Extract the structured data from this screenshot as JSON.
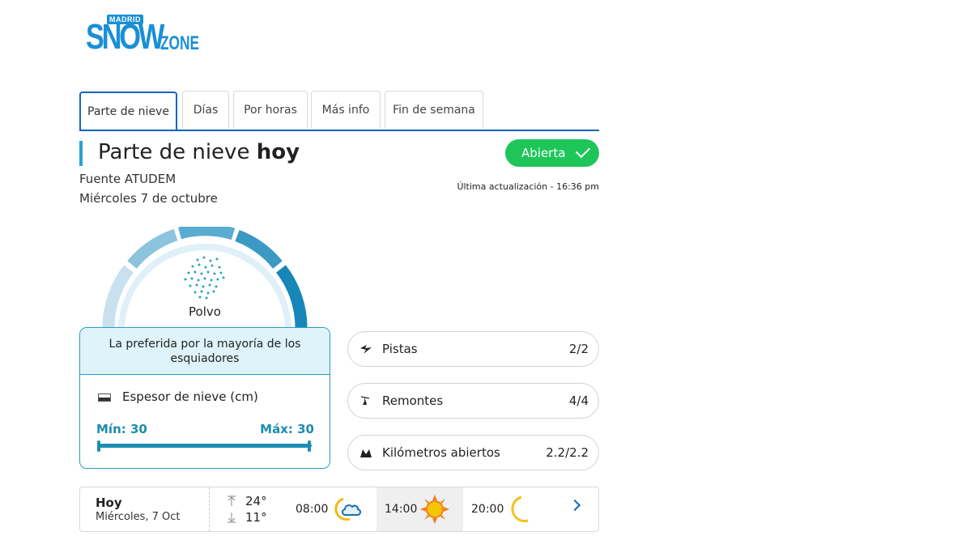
{
  "logo": {
    "madrid": "MADRID",
    "snow": "SNOW",
    "zone": "ZONE"
  },
  "tabs": [
    {
      "label": "Parte de nieve",
      "active": true
    },
    {
      "label": "Días"
    },
    {
      "label": "Por horas"
    },
    {
      "label": "Más info"
    },
    {
      "label": "Fin de semana"
    }
  ],
  "header": {
    "title_main": "Parte de nieve ",
    "title_bold": "hoy",
    "fuente": "Fuente ATUDEM",
    "fecha": "Miércoles 7 de octubre",
    "status": "Abierta",
    "updated": "Última actualización - 16:36 pm"
  },
  "snow": {
    "type": "Polvo",
    "note": "La preferida por la mayoría de los esquiadores",
    "espesor_label": "Espesor de nieve (cm)",
    "min_label": "Mín: 30",
    "max_label": "Máx: 30"
  },
  "stats": [
    {
      "label": "Pistas",
      "value": "2/2",
      "icon": "slope-icon"
    },
    {
      "label": "Remontes",
      "value": "4/4",
      "icon": "lift-icon"
    },
    {
      "label": "Kilómetros abiertos",
      "value": "2.2/2.2",
      "icon": "mountain-icon"
    }
  ],
  "forecast": {
    "day": "Hoy",
    "date": "Miércoles, 7 Oct",
    "max": "24°",
    "min": "11°",
    "slots": [
      {
        "time": "08:00",
        "icon": "moon-cloud-icon"
      },
      {
        "time": "14:00",
        "icon": "sun-icon"
      },
      {
        "time": "20:00",
        "icon": "moon-icon"
      }
    ]
  },
  "colors": {
    "accent": "#1565c0",
    "open": "#1ec65a",
    "snow": "#1b8db3"
  }
}
